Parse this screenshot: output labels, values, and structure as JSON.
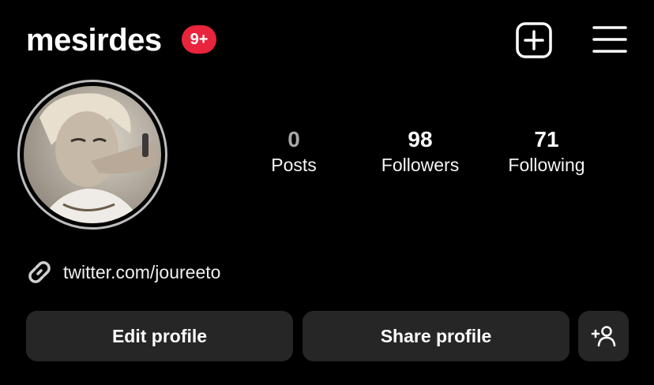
{
  "header": {
    "username": "mesirdes",
    "notification_badge": "9+",
    "badge_color": "#e9243d",
    "new_post_icon": "plus-square-icon",
    "menu_icon": "hamburger-menu-icon"
  },
  "profile": {
    "avatar": "profile-photo",
    "stats": [
      {
        "value": "0",
        "label": "Posts"
      },
      {
        "value": "98",
        "label": "Followers"
      },
      {
        "value": "71",
        "label": "Following"
      }
    ],
    "link_icon": "link-icon",
    "link_text": "twitter.com/joureeto"
  },
  "actions": {
    "edit_label": "Edit profile",
    "share_label": "Share profile",
    "add_icon": "add-person-icon"
  },
  "colors": {
    "background": "#000000",
    "button_bg": "#262626",
    "text": "#ffffff"
  }
}
